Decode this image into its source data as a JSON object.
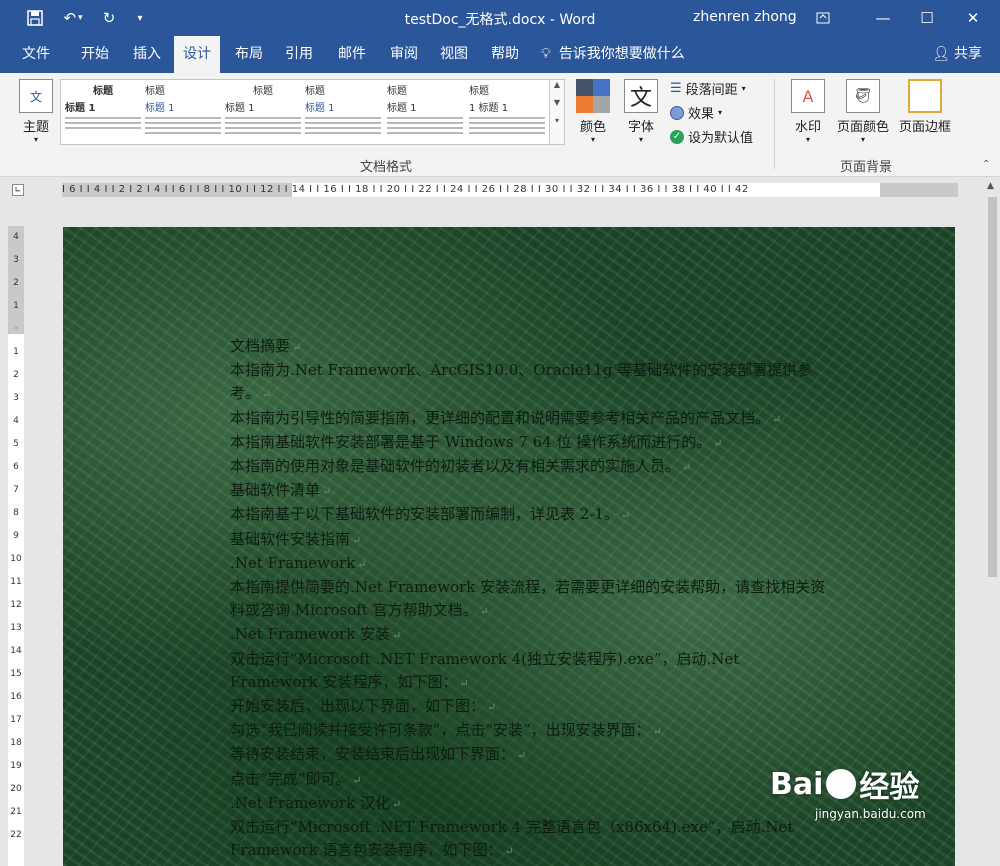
{
  "window": {
    "title": "testDoc_无格式.docx - Word",
    "user": "zhenren zhong"
  },
  "menu": {
    "tabs": [
      "文件",
      "开始",
      "插入",
      "设计",
      "布局",
      "引用",
      "邮件",
      "审阅",
      "视图",
      "帮助"
    ],
    "active": "设计",
    "tell_me": "告诉我你想要做什么",
    "share": "共享"
  },
  "ribbon": {
    "theme_label": "主题",
    "gallery": [
      {
        "heading": "标题",
        "sub": "标题 1"
      },
      {
        "heading": "标题",
        "sub": "标题 1"
      },
      {
        "heading": "标题",
        "sub": "标题 1"
      },
      {
        "heading": "标题",
        "sub": "标题 1"
      },
      {
        "heading": "标题",
        "sub": "标题 1"
      },
      {
        "heading": "标题",
        "sub": "1 标题 1"
      }
    ],
    "colors_label": "颜色",
    "fonts_label": "字体",
    "paragraph_spacing": "段落间距",
    "effects": "效果",
    "set_default": "设为默认值",
    "doc_format_group": "文档格式",
    "watermark": "水印",
    "page_color": "页面颜色",
    "page_borders": "页面边框",
    "page_bg_group": "页面背景"
  },
  "ruler": {
    "h_numbers": "I 6 I  I 4 I  I 2 I       2      I 4 I  I 6 I  I 8 I  I 10 I  I 12 I  I 14 I  I 16 I  I 18 I  I 20 I  I 22 I  I 24 I  I 26 I  I 28 I  I 30 I  I 32 I  I 34 I  I 36 I  I 38 I  I 40 I  I 42",
    "v_numbers": [
      "4",
      "3",
      "2",
      "1",
      "",
      "1",
      "2",
      "3",
      "4",
      "5",
      "6",
      "7",
      "8",
      "9",
      "10",
      "11",
      "12",
      "13",
      "14",
      "15",
      "16",
      "17",
      "18",
      "19",
      "20",
      "21",
      "22"
    ]
  },
  "document": {
    "paragraphs": [
      "文档摘要",
      "本指南为.Net Framework、ArcGIS10.0、Oracle11g 等基础软件的安装部署提供参考。",
      "本指南为引导性的简要指南，更详细的配置和说明需要参考相关产品的产品文档。",
      "本指南基础软件安装部署是基于 Windows 7 64 位 操作系统而进行的。",
      "本指南的使用对象是基础软件的初装者以及有相关需求的实施人员。",
      "基础软件清单",
      "本指南基于以下基础软件的安装部署而编制，详见表 2-1。",
      "基础软件安装指南",
      ".Net Framework",
      "本指南提供简要的.Net Framework 安装流程，若需要更详细的安装帮助，请查找相关资料或咨询 Microsoft 官方帮助文档。",
      ".Net Framework 安装",
      "双击运行“Microsoft .NET Framework 4(独立安装程序).exe”，启动.Net Framework 安装程序，如下图：",
      "开始安装后，出现以下界面，如下图：",
      "勾选“我已阅读并接受许可条款”，点击“安装”，出现安装界面：",
      "等待安装结束，安装结束后出现如下界面：",
      "点击“完成”即可。",
      ".Net Framework 汉化",
      "双击运行“Microsoft .NET Framework 4 完整语言包（x86x64).exe”，启动.Net Framework 语言包安装程序，如下图："
    ]
  },
  "watermark": {
    "logo_text_left": "Bai",
    "logo_text_right": "经验",
    "url": "jingyan.baidu.com"
  }
}
